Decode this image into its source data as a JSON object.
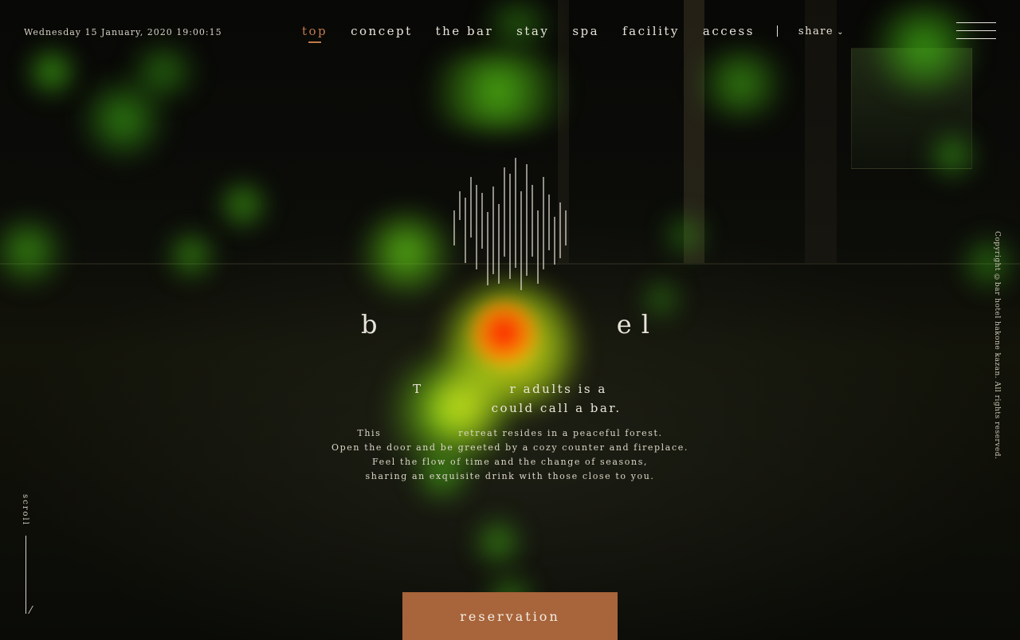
{
  "header": {
    "datetime": "Wednesday 15 January, 2020 19:00:15",
    "nav": [
      {
        "label": "top",
        "active": true
      },
      {
        "label": "concept"
      },
      {
        "label": "the bar"
      },
      {
        "label": "stay"
      },
      {
        "label": "spa"
      },
      {
        "label": "facility"
      },
      {
        "label": "access"
      }
    ],
    "share_label": "share",
    "share_icon": "chevron-down-icon",
    "menu_icon": "hamburger-menu-icon"
  },
  "hero": {
    "logo_icon": "vertical-lines-logo",
    "logo_text": "b             el",
    "tagline_lines": [
      "T               r adults is a",
      "                could call a bar."
    ],
    "description_lines": [
      "This                   retreat resides in a peaceful forest.",
      "Open the door and be greeted by a cozy counter and fireplace.",
      "Feel the flow of time and the change of seasons,",
      "sharing an exquisite drink with those close to you."
    ]
  },
  "sidebar": {
    "scroll_label": "scroll"
  },
  "footer": {
    "copyright": "Copyright ©bar hotel hakone kazan. All rights reserved.",
    "reservation_label": "reservation"
  },
  "colors": {
    "accent": "#c07a4b",
    "reservation_bg": "#a8643a",
    "background": "#050604",
    "text": "#e9e4da"
  }
}
